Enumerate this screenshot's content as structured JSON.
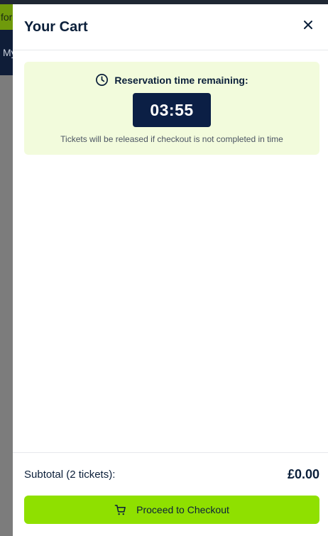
{
  "background": {
    "promo_text": "for",
    "nav_text": "My"
  },
  "cart": {
    "title": "Your Cart",
    "close_icon": "close-icon"
  },
  "reservation": {
    "icon": "clock-icon",
    "heading": "Reservation time remaining:",
    "time": "03:55",
    "note": "Tickets will be released if checkout is not completed in time"
  },
  "footer": {
    "subtotal_label": "Subtotal (2 tickets):",
    "subtotal_value": "£0.00",
    "checkout_icon": "cart-icon",
    "checkout_label": "Proceed to Checkout"
  },
  "colors": {
    "accent": "#8fe000",
    "navy": "#0b1f45",
    "timer_bg": "#f2fbdc"
  }
}
